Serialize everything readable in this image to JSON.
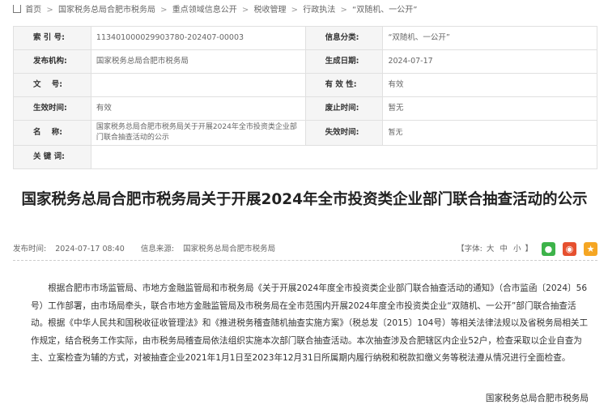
{
  "breadcrumb": {
    "items": [
      "首页",
      "国家税务总局合肥市税务局",
      "重点领域信息公开",
      "税收管理",
      "行政执法",
      "“双随机、一公开”"
    ],
    "separator": ">"
  },
  "meta": {
    "rows": [
      [
        {
          "label": "索 引 号:",
          "value": "113401000029903780-202407-00003"
        },
        {
          "label": "信息分类:",
          "value": "“双随机、一公开”"
        }
      ],
      [
        {
          "label": "发布机构:",
          "value": "国家税务总局合肥市税务局"
        },
        {
          "label": "生成日期:",
          "value": "2024-07-17"
        }
      ],
      [
        {
          "label": "文    号:",
          "value": ""
        },
        {
          "label": "有 效 性:",
          "value": "有效"
        }
      ],
      [
        {
          "label": "生效时间:",
          "value": "有效"
        },
        {
          "label": "废止时间:",
          "value": "暂无"
        }
      ],
      [
        {
          "label": "名    称:",
          "value": "国家税务总局合肥市税务局关于开展2024年全市投资类企业部门联合抽查活动的公示"
        },
        {
          "label": "失效时间:",
          "value": "暂无"
        }
      ],
      [
        {
          "label": "关 键 词:",
          "value": ""
        }
      ]
    ]
  },
  "article": {
    "title": "国家税务总局合肥市税务局关于开展2024年全市投资类企业部门联合抽查活动的公示",
    "publish_label": "发布时间:",
    "publish_time": "2024-07-17 08:40",
    "source_label": "信息来源:",
    "source": "国家税务总局合肥市税务局",
    "font_label": "【字体:",
    "font_sizes": [
      "大",
      "中",
      "小"
    ],
    "font_close": "】",
    "body": "根据合肥市市场监管局、市地方金融监管局和市税务局《关于开展2024年度全市投资类企业部门联合抽查活动的通知》（合市监函〔2024〕56号）工作部署，由市场局牵头，联合市地方金融监管局及市税务局在全市范围内开展2024年度全市投资类企业“双随机、一公开”部门联合抽查活动。根据《中华人民共和国税收征收管理法》和《推进税务稽查随机抽查实施方案》（税总发〔2015〕104号）等相关法律法规以及省税务局相关工作规定，结合税务工作实际，由市税务局稽查局依法组织实施本次部门联合抽查活动。本次抽查涉及合肥辖区内企业52户，检查采取以企业自查为主、立案检查为辅的方式，对被抽查企业2021年1月1日至2023年12月31日所属期内履行纳税和税款扣缴义务等税法遵从情况进行全面检查。",
    "signature": "国家税务总局合肥市税务局"
  },
  "icons": {
    "share_wechat": "wechat-icon",
    "share_weibo": "weibo-icon",
    "favorite": "star-icon"
  },
  "colors": {
    "wechat": "#3db34a",
    "weibo": "#e6502f",
    "favorite": "#f5a623"
  }
}
